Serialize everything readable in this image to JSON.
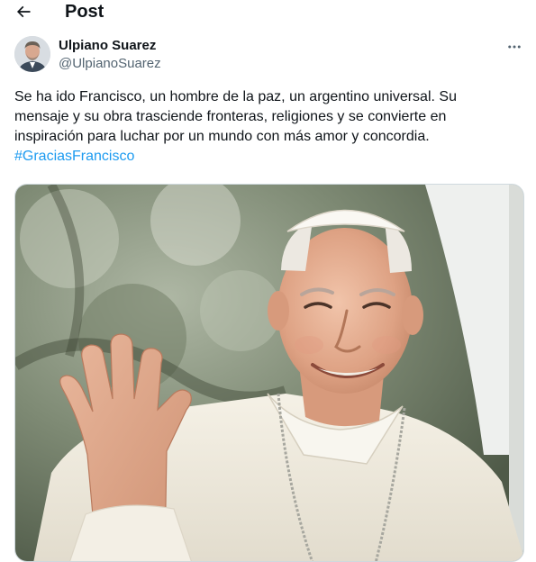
{
  "header": {
    "title": "Post",
    "back_icon": "arrow-left-icon"
  },
  "author": {
    "name": "Ulpiano Suarez",
    "handle": "@UlpianoSuarez",
    "avatar_icon": "user-avatar"
  },
  "more_icon": "more-horizontal-icon",
  "tweet": {
    "lines": [
      "Se ha ido Francisco, un hombre de la paz, un argentino universal. Su",
      "mensaje y su obra trasciende fronteras, religiones y se convierte en",
      "inspiración para luchar por un mundo con más amor y concordia."
    ],
    "hashtag": "#GraciasFrancisco"
  },
  "media": {
    "type": "photo"
  },
  "colors": {
    "text": "#0f1419",
    "secondary": "#536471",
    "link": "#1d9bf0",
    "border": "#cfd9de"
  }
}
